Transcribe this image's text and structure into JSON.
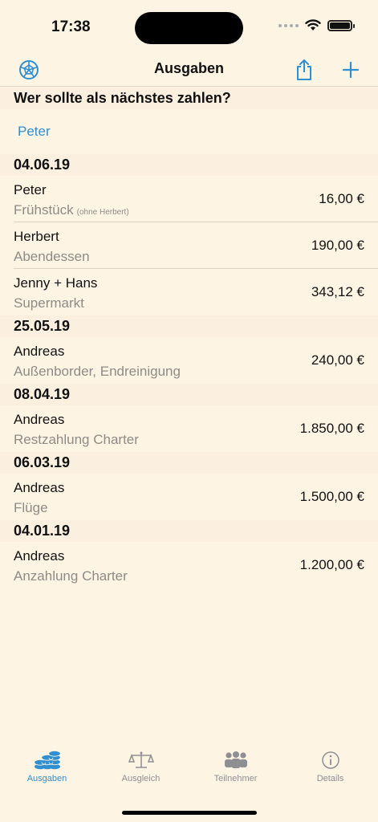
{
  "status": {
    "time": "17:38"
  },
  "nav": {
    "title": "Ausgaben",
    "left_icon": "wheel-icon",
    "share_icon": "share-icon",
    "add_icon": "plus-icon"
  },
  "question": {
    "title": "Wer sollte als nächstes zahlen?",
    "answer": "Peter"
  },
  "groups": [
    {
      "date": "04.06.19",
      "items": [
        {
          "payer": "Peter",
          "description": "Frühstück",
          "note": "(ohne Herbert)",
          "amount": "16,00 €"
        },
        {
          "payer": "Herbert",
          "description": "Abendessen",
          "note": "",
          "amount": "190,00 €"
        },
        {
          "payer": "Jenny + Hans",
          "description": "Supermarkt",
          "note": "",
          "amount": "343,12 €"
        }
      ]
    },
    {
      "date": "25.05.19",
      "items": [
        {
          "payer": "Andreas",
          "description": "Außenborder, Endreinigung",
          "note": "",
          "amount": "240,00 €"
        }
      ]
    },
    {
      "date": "08.04.19",
      "items": [
        {
          "payer": "Andreas",
          "description": "Restzahlung Charter",
          "note": "",
          "amount": "1.850,00 €"
        }
      ]
    },
    {
      "date": "06.03.19",
      "items": [
        {
          "payer": "Andreas",
          "description": "Flüge",
          "note": "",
          "amount": "1.500,00 €"
        }
      ]
    },
    {
      "date": "04.01.19",
      "items": [
        {
          "payer": "Andreas",
          "description": "Anzahlung Charter",
          "note": "",
          "amount": "1.200,00 €"
        }
      ]
    }
  ],
  "tabs": [
    {
      "label": "Ausgaben",
      "icon": "coins-icon",
      "active": true
    },
    {
      "label": "Ausgleich",
      "icon": "scale-icon",
      "active": false
    },
    {
      "label": "Teilnehmer",
      "icon": "people-icon",
      "active": false
    },
    {
      "label": "Details",
      "icon": "info-icon",
      "active": false
    }
  ],
  "colors": {
    "background": "#fef4e4",
    "accent": "#2f8fd0",
    "header": "#fbefe0",
    "secondary_text": "#8e8a86"
  }
}
